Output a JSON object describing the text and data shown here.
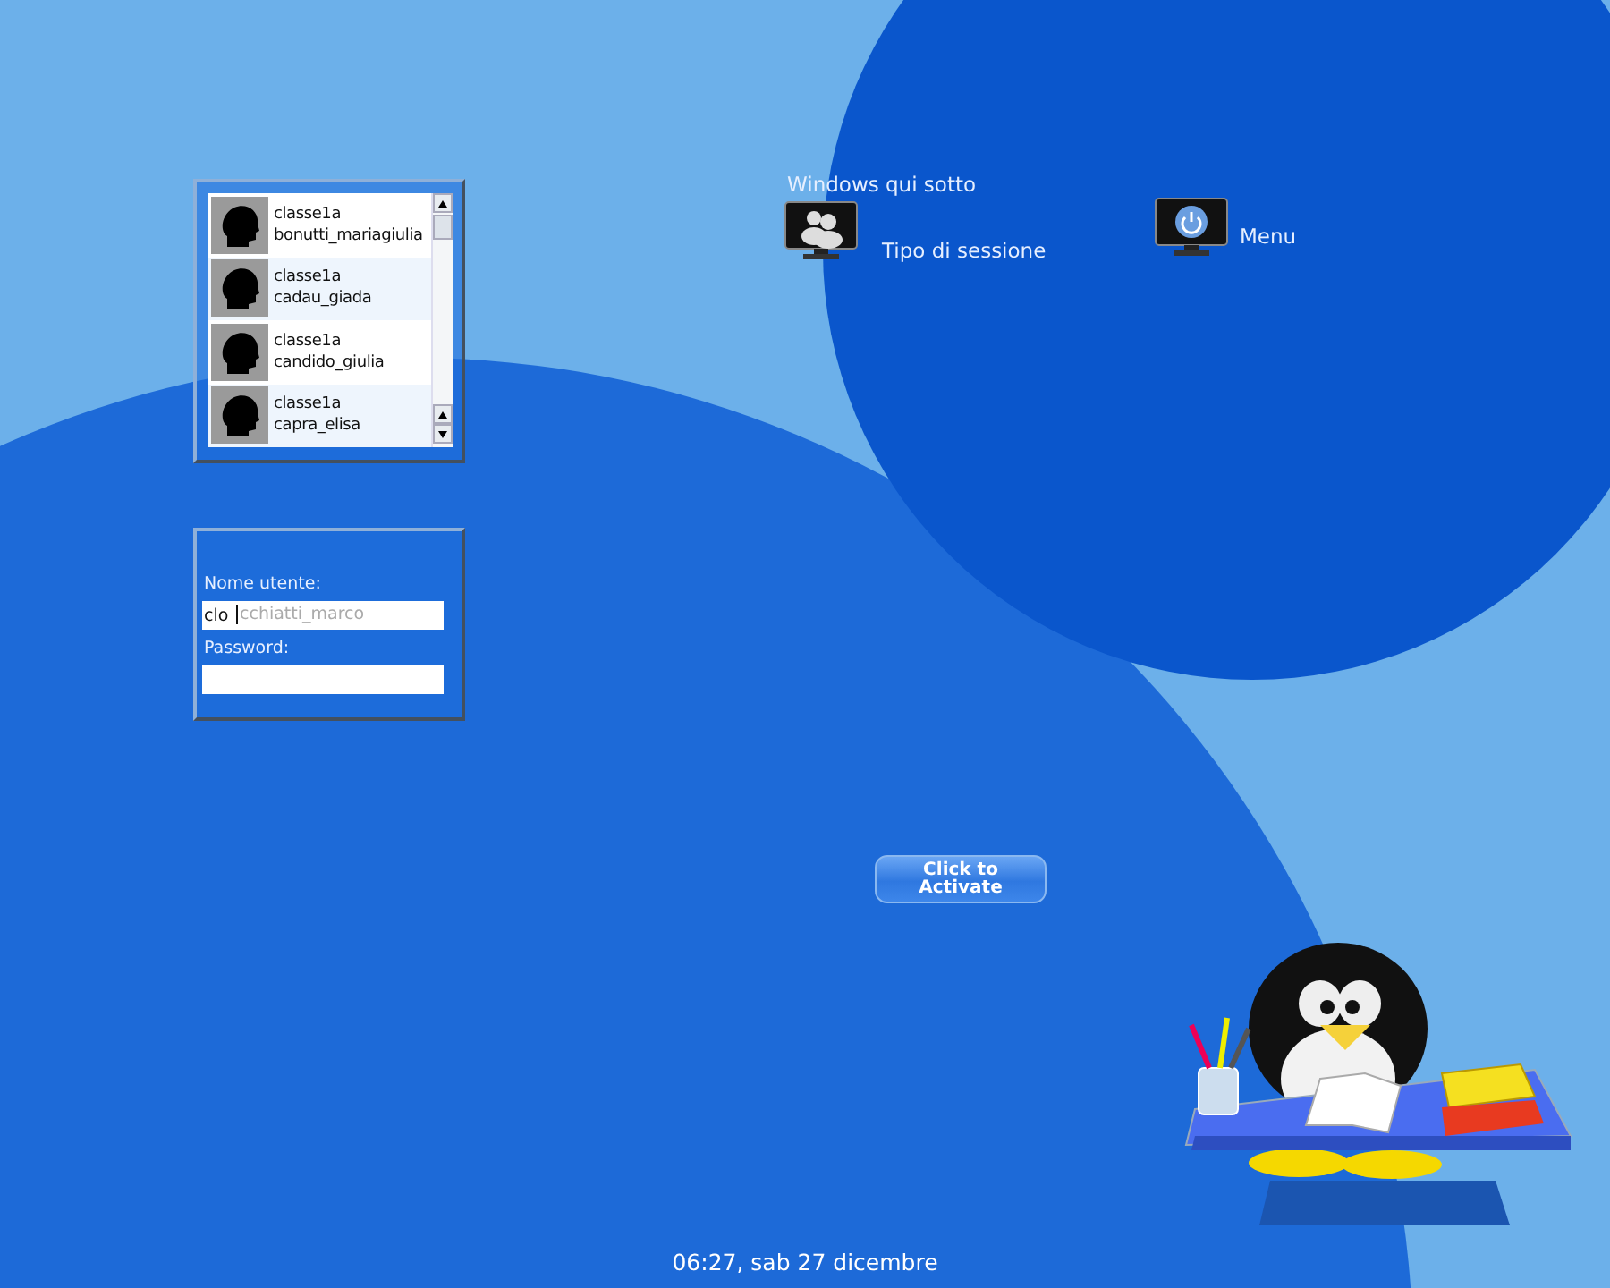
{
  "user_list": {
    "users": [
      {
        "group": "classe1a",
        "username": "bonutti_mariagiulia",
        "selected": false
      },
      {
        "group": "classe1a",
        "username": "cadau_giada",
        "selected": false
      },
      {
        "group": "classe1a",
        "username": "candido_giulia",
        "selected": false
      },
      {
        "group": "classe1a",
        "username": "capra_elisa",
        "selected": false
      }
    ]
  },
  "login": {
    "username_label": "Nome utente:",
    "username_value": "clo",
    "username_completion": "cchiatti_marco",
    "password_label": "Password:"
  },
  "session": {
    "heading": "Windows qui sotto",
    "session_label": "Tipo di sessione",
    "menu_label": "Menu"
  },
  "activate_button": "Click to\nActivate",
  "clock": "06:27, sab 27 dicembre"
}
